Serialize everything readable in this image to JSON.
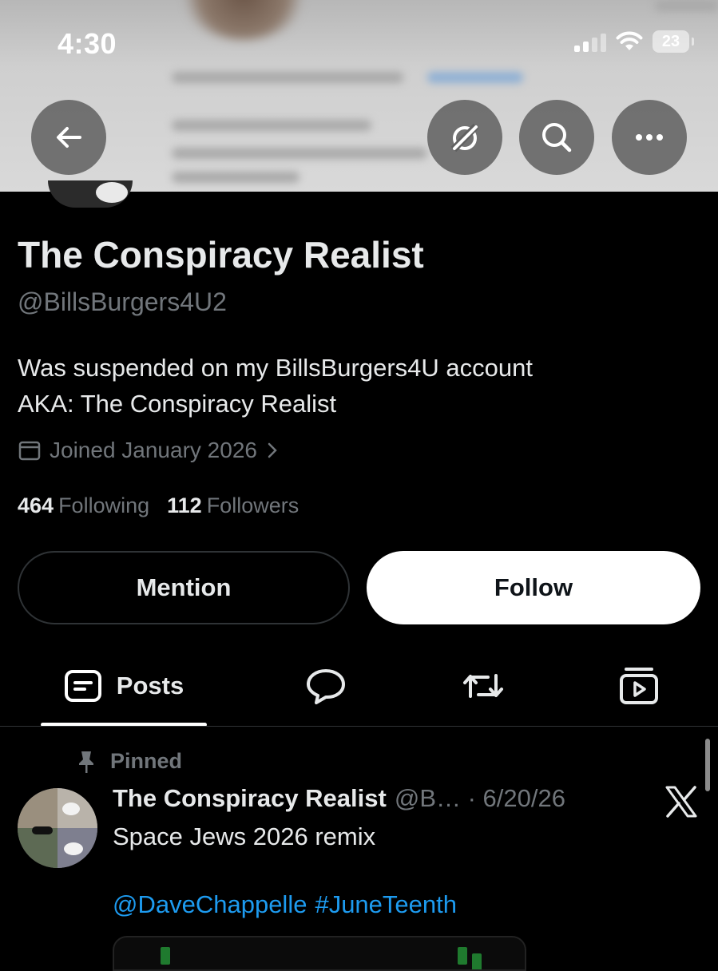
{
  "status_bar": {
    "time": "4:30",
    "battery": "23"
  },
  "header": {
    "back_icon": "arrow-left-icon",
    "grok_icon": "grok-slash-icon",
    "search_icon": "search-icon",
    "more_icon": "more-horizontal-icon"
  },
  "profile": {
    "display_name": "The Conspiracy Realist",
    "handle": "@BillsBurgers4U2",
    "bio_line1": "Was suspended on my BillsBurgers4U account",
    "bio_line2": "AKA: The Conspiracy Realist",
    "joined": "Joined January 2026",
    "following_count": "464",
    "following_label": "Following",
    "followers_count": "112",
    "followers_label": "Followers"
  },
  "actions": {
    "mention_label": "Mention",
    "follow_label": "Follow"
  },
  "tabs": {
    "posts_label": "Posts"
  },
  "post": {
    "pinned_label": "Pinned",
    "author": "The Conspiracy Realist",
    "meta": "@B… · 6/20/26",
    "text": "Space Jews 2026 remix",
    "mention": "@DaveChappelle",
    "hashtag": "#JuneTeenth"
  },
  "colors": {
    "background": "#000000",
    "text_primary": "#e7e9ea",
    "text_secondary": "#71767b",
    "link": "#1d9bf0",
    "border": "#2f3336"
  }
}
